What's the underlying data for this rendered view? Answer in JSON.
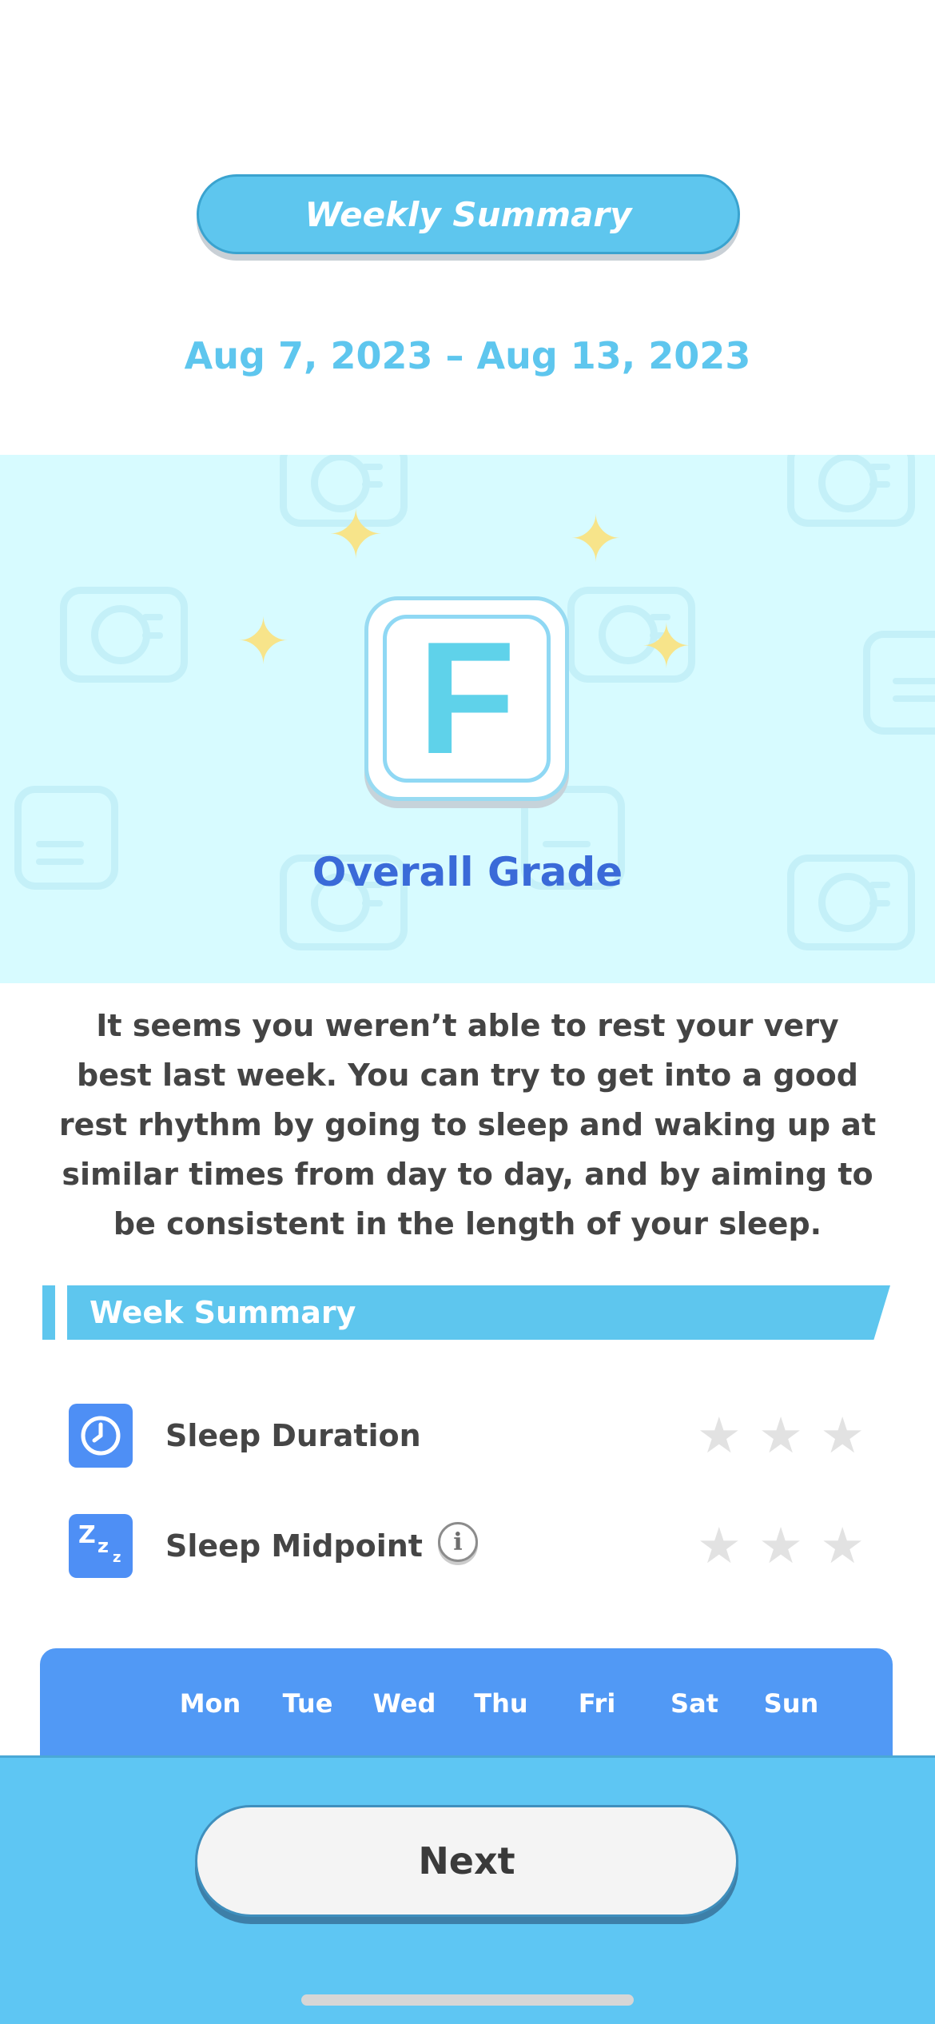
{
  "header": {
    "title": "Weekly Summary",
    "date_range": "Aug 7, 2023 – Aug 13, 2023"
  },
  "grade": {
    "letter": "F",
    "caption": "Overall Grade"
  },
  "message": "It seems you weren’t able to rest your very best last week. You can try to get into a good rest rhythm by going to sleep and waking up at similar times from day to day, and by aiming to be consistent in the length of your sleep.",
  "week_summary": {
    "title": "Week Summary",
    "metrics": [
      {
        "label": "Sleep Duration",
        "icon": "clock-icon",
        "stars": 0,
        "max_stars": 3
      },
      {
        "label": "Sleep Midpoint",
        "icon": "zzz-icon",
        "stars": 0,
        "max_stars": 3,
        "icon_text": "Zzz"
      }
    ]
  },
  "days": [
    "Mon",
    "Tue",
    "Wed",
    "Thu",
    "Fri",
    "Sat",
    "Sun"
  ],
  "footer": {
    "next_label": "Next"
  },
  "colors": {
    "accent": "#5ec6ee",
    "hero_bg": "#d7fbff",
    "grade_text": "#5fd2ea",
    "caption_text": "#3a6ad8",
    "icon_bg": "#4e8ff5",
    "day_panel": "#5199f5",
    "footer_bg": "#5ec6f3",
    "star_empty": "#e2e2e2"
  }
}
